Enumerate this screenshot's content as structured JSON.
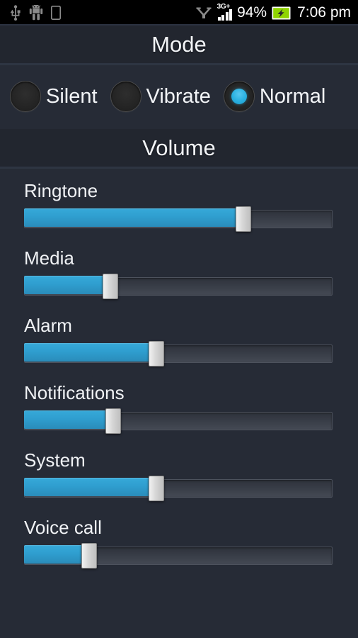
{
  "statusbar": {
    "left_icons": [
      {
        "name": "usb-icon",
        "glyph": "usb"
      },
      {
        "name": "android-robot-icon",
        "glyph": "android"
      },
      {
        "name": "sd-card-icon",
        "glyph": "sdcard"
      }
    ],
    "vpn_icon": "vpn-icon",
    "network_type": "3G+",
    "signal_bars": 4,
    "battery_percent": "94%",
    "battery_state": "charging",
    "time": "7:06 pm"
  },
  "mode": {
    "header": "Mode",
    "options": [
      {
        "label": "Silent",
        "selected": false
      },
      {
        "label": "Vibrate",
        "selected": false
      },
      {
        "label": "Normal",
        "selected": true
      }
    ],
    "selected_color": "#29b0e0"
  },
  "volume": {
    "header": "Volume",
    "accent_color": "#2f9ecf",
    "sliders": [
      {
        "label": "Ringtone",
        "percent": 71
      },
      {
        "label": "Media",
        "percent": 28
      },
      {
        "label": "Alarm",
        "percent": 43
      },
      {
        "label": "Notifications",
        "percent": 29
      },
      {
        "label": "System",
        "percent": 43
      },
      {
        "label": "Voice call",
        "percent": 21
      }
    ]
  }
}
